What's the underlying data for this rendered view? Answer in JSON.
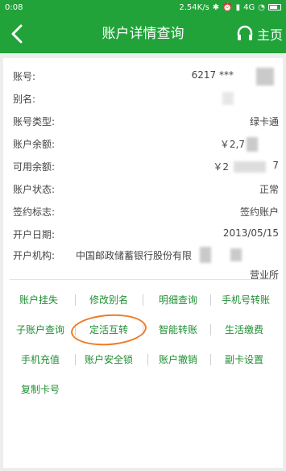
{
  "status": {
    "time": "0:08",
    "net": "2.54K/s",
    "signal": "4G"
  },
  "nav": {
    "title": "账户详情查询",
    "home_label": "主页"
  },
  "details": [
    {
      "label": "账号:",
      "value": "6217 ***"
    },
    {
      "label": "别名:",
      "value": ""
    },
    {
      "label": "账号类型:",
      "value": "绿卡通"
    },
    {
      "label": "账户余额:",
      "value": "￥2,7"
    },
    {
      "label": "可用余额:",
      "value": "￥2"
    },
    {
      "label": "账户状态:",
      "value": "正常"
    },
    {
      "label": "签约标志:",
      "value": "签约账户"
    },
    {
      "label": "开户日期:",
      "value": "2013/05/15"
    },
    {
      "label": "开户机构:",
      "value": "中国邮政储蓄银行股份有限"
    }
  ],
  "extra": {
    "avail_tail": "7",
    "branch_suffix": "营业所"
  },
  "actions": [
    "账户挂失",
    "修改别名",
    "明细查询",
    "手机号转账",
    "子账户查询",
    "定活互转",
    "智能转账",
    "生活缴费",
    "手机充值",
    "账户安全锁",
    "账户撤销",
    "副卡设置",
    "复制卡号"
  ],
  "colors": {
    "header": "#21a33a",
    "action_text": "#1f8f33",
    "annotation": "#f07a26"
  }
}
